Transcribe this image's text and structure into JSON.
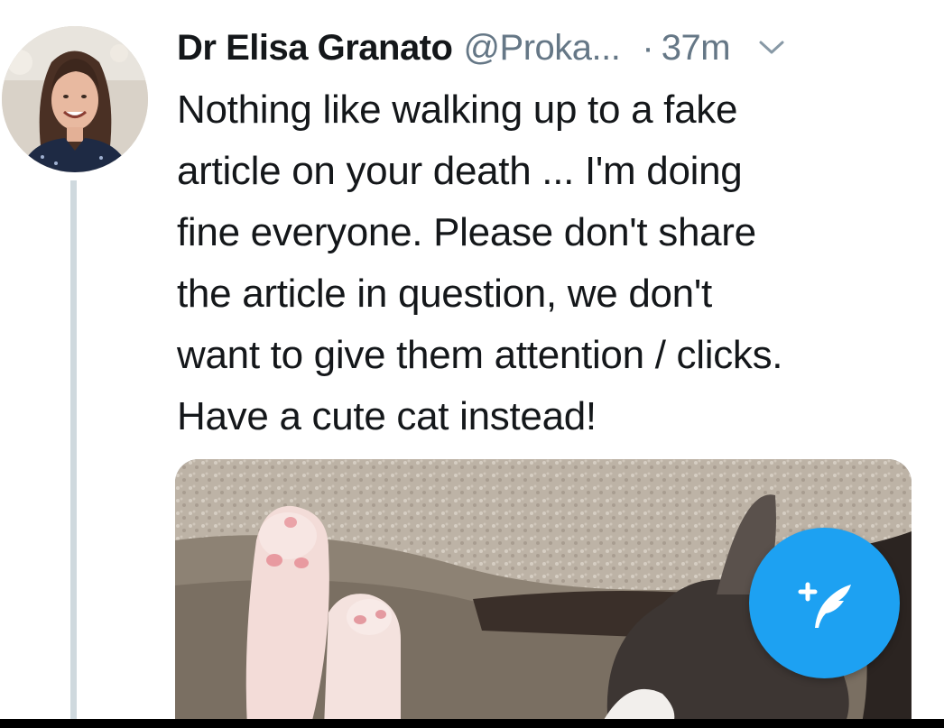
{
  "tweet": {
    "author_name": "Dr Elisa Granato",
    "author_handle": "@Proka...",
    "separator": "·",
    "timestamp": "37m",
    "text_lines": [
      "Nothing like walking up to a fake",
      "article on your death ... I'm doing",
      "fine everyone. Please don't share",
      "the article in question, we don't",
      "want to give them attention / clicks.",
      "Have a cute cat instead!"
    ],
    "media": {
      "icon": "cat-photo"
    }
  },
  "compose_button": {
    "icon": "compose-tweet-icon"
  },
  "colors": {
    "accent": "#1da1f2",
    "text_primary": "#14171a",
    "text_secondary": "#657786",
    "thread_line": "#cfd9de"
  }
}
